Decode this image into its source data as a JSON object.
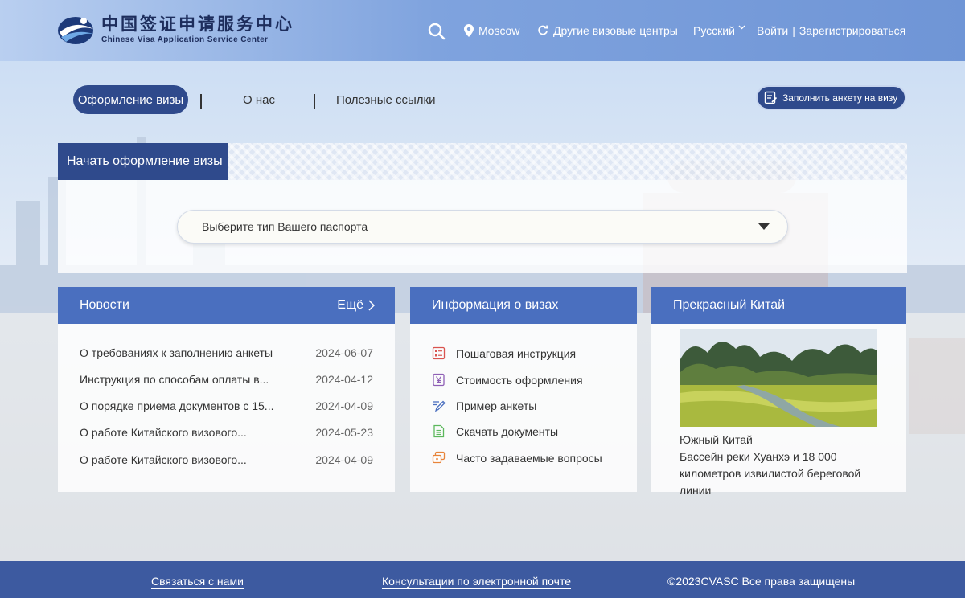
{
  "header": {
    "logo_cn": "中国签证申请服务中心",
    "logo_en": "Chinese Visa Application Service Center",
    "location": "Moscow",
    "other_centers": "Другие визовые центры",
    "language": "Русский",
    "login": "Войти",
    "divider": "|",
    "register": "Зарегистрироваться"
  },
  "nav": {
    "items": [
      "Оформление визы",
      "О нас",
      "Полезные ссылки"
    ],
    "fill_form_button": "Заполнить анкету на визу"
  },
  "start": {
    "tab_label": "Начать оформление визы",
    "passport_select_placeholder": "Выберите тип Вашего паспорта"
  },
  "news": {
    "title": "Новости",
    "more": "Ещё",
    "items": [
      {
        "title": "О требованиях к заполнению анкеты",
        "date": "2024-06-07"
      },
      {
        "title": "Инструкция по способам оплаты в...",
        "date": "2024-04-12"
      },
      {
        "title": "О порядке приема документов с 15...",
        "date": "2024-04-09"
      },
      {
        "title": "О работе Китайского визового...",
        "date": "2024-05-23"
      },
      {
        "title": "О работе Китайского визового...",
        "date": "2024-04-09"
      }
    ]
  },
  "visa_info": {
    "title": "Информация о визах",
    "items": [
      {
        "label": "Пошаговая инструкция",
        "icon": "checklist-icon"
      },
      {
        "label": "Стоимость оформления",
        "icon": "yuan-icon"
      },
      {
        "label": "Пример анкеты",
        "icon": "pen-icon"
      },
      {
        "label": "Скачать документы",
        "icon": "document-icon"
      },
      {
        "label": "Часто задаваемые вопросы",
        "icon": "faq-icon"
      }
    ]
  },
  "china": {
    "title": "Прекрасный Китай",
    "caption_line1": "Южный Китай",
    "caption_line2": "Бассейн реки Хуанхэ и 18 000 километров извилистой береговой линии"
  },
  "footer": {
    "contact": "Связаться с нами",
    "email": "Консультации по электронной почте",
    "copyright": "©2023CVASC Все права защищены"
  },
  "colors": {
    "brand_dark": "#2f4a8c",
    "card_header": "#4a6fbf",
    "footer": "#3d5aa0",
    "icon_accent": "#d9534f"
  }
}
